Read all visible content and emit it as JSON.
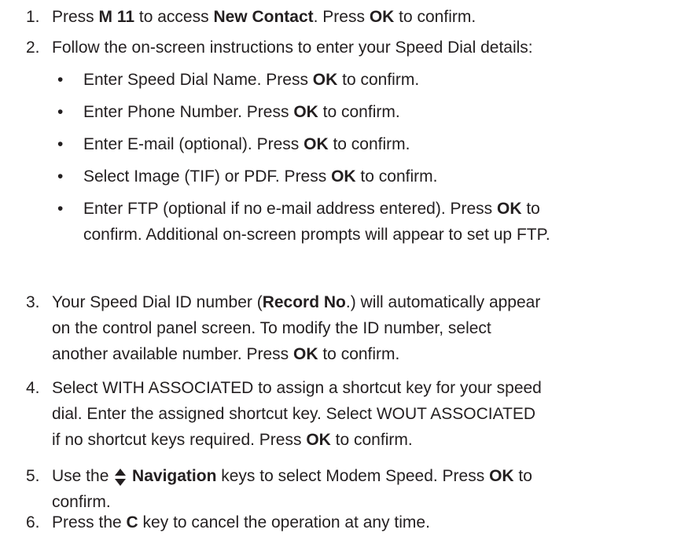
{
  "steps": [
    {
      "number": "1.",
      "lines": [
        [
          {
            "t": "Press "
          },
          {
            "t": "M 11",
            "b": true
          },
          {
            "t": " to access "
          },
          {
            "t": "New Contact",
            "b": true
          },
          {
            "t": ". Press "
          },
          {
            "t": "OK",
            "b": true
          },
          {
            "t": " to confirm."
          }
        ]
      ]
    },
    {
      "number": "2.",
      "lines": [
        [
          {
            "t": "Follow the on-screen instructions to enter your Speed Dial details:"
          }
        ]
      ],
      "bullets": [
        {
          "lines": [
            [
              {
                "t": "Enter Speed Dial Name.  Press "
              },
              {
                "t": "OK",
                "b": true
              },
              {
                "t": " to confirm."
              }
            ]
          ]
        },
        {
          "lines": [
            [
              {
                "t": "Enter Phone Number.  Press "
              },
              {
                "t": "OK",
                "b": true
              },
              {
                "t": " to confirm."
              }
            ]
          ]
        },
        {
          "lines": [
            [
              {
                "t": "Enter E-mail (optional).  Press "
              },
              {
                "t": "OK",
                "b": true
              },
              {
                "t": " to confirm."
              }
            ]
          ]
        },
        {
          "lines": [
            [
              {
                "t": "Select Image (TIF) or PDF.  Press "
              },
              {
                "t": "OK",
                "b": true
              },
              {
                "t": " to confirm."
              }
            ]
          ]
        },
        {
          "lines": [
            [
              {
                "t": "Enter FTP (optional if no e-mail address entered).  Press "
              },
              {
                "t": "OK",
                "b": true
              },
              {
                "t": " to"
              }
            ],
            [
              {
                "t": "confirm.  Additional on-screen prompts will appear to set up FTP."
              }
            ]
          ]
        }
      ]
    },
    {
      "number": "3.",
      "lines": [
        [
          {
            "t": "Your Speed Dial ID number ("
          },
          {
            "t": "Record No",
            "b": true
          },
          {
            "t": ".) will automatically appear"
          }
        ],
        [
          {
            "t": "on the control panel screen.  To modify the ID number, select"
          }
        ],
        [
          {
            "t": "another available number.  Press "
          },
          {
            "t": "OK",
            "b": true
          },
          {
            "t": " to confirm."
          }
        ]
      ]
    },
    {
      "number": "4.",
      "lines": [
        [
          {
            "t": "Select WITH ASSOCIATED to assign a shortcut key for your speed"
          }
        ],
        [
          {
            "t": "dial. Enter the assigned shortcut key.  Select WOUT ASSOCIATED"
          }
        ],
        [
          {
            "t": "if no shortcut keys required.  Press "
          },
          {
            "t": "OK",
            "b": true
          },
          {
            "t": " to confirm."
          }
        ]
      ]
    },
    {
      "number": "5.",
      "lines": [
        [
          {
            "t": "Use the "
          },
          {
            "icon": "up-down-navigation-icon"
          },
          {
            "t": " Navigation",
            "b": true
          },
          {
            "t": " keys to select Modem Speed.  Press "
          },
          {
            "t": "OK",
            "b": true
          },
          {
            "t": " to"
          }
        ],
        [
          {
            "t": "confirm."
          }
        ]
      ]
    },
    {
      "number": "6.",
      "lines": [
        [
          {
            "t": "Press the "
          },
          {
            "t": "C",
            "b": true
          },
          {
            "t": " key to cancel the operation at any time."
          }
        ]
      ]
    }
  ],
  "bullet_char": "•",
  "colors": {
    "text": "#231f20",
    "background": "#ffffff"
  }
}
